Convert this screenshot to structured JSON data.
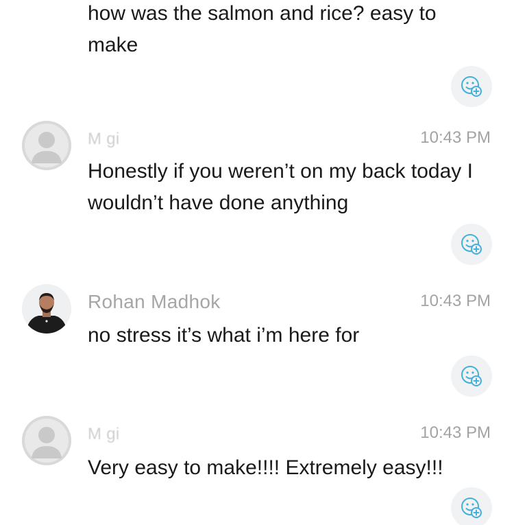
{
  "messages": [
    {
      "text": "how was the salmon and rice? easy to make"
    },
    {
      "author": "M          gi",
      "time": "10:43 PM",
      "text": "Honestly if you weren’t on my back today I wouldn’t have done anything"
    },
    {
      "author": "Rohan Madhok",
      "time": "10:43 PM",
      "text": "no stress it’s what i’m here for"
    },
    {
      "author": "M          gi",
      "time": "10:43 PM",
      "text": "Very easy to make!!!! Extremely easy!!!"
    }
  ],
  "icons": {
    "reaction": "add-reaction-icon",
    "avatar_placeholder": "user-silhouette-icon"
  },
  "colors": {
    "accent": "#43b0da",
    "meta_text": "#a6a6a6",
    "body_text": "#1a1a1a"
  }
}
